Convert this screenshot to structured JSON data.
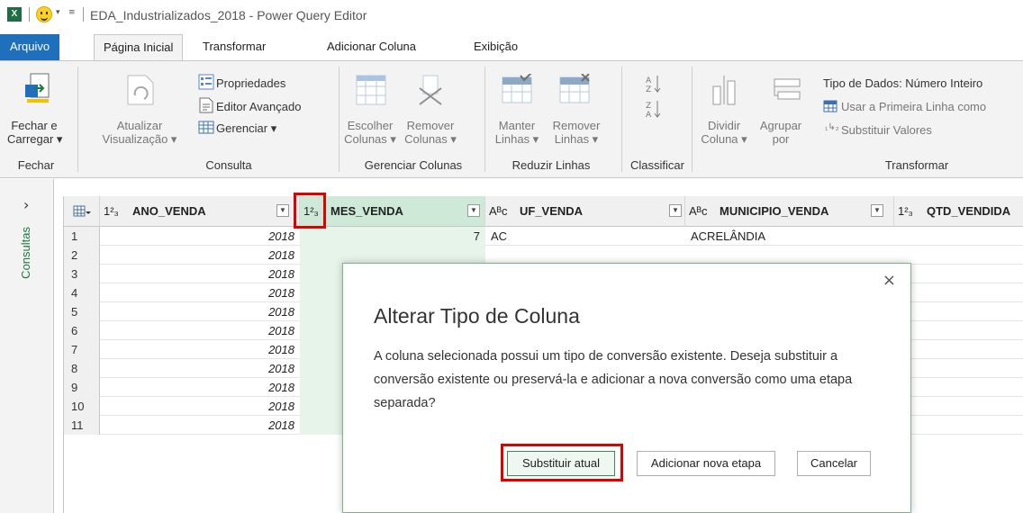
{
  "window": {
    "title": "EDA_Industrializados_2018 - Power Query Editor",
    "app_icon": "X"
  },
  "tabs": [
    "Arquivo",
    "Página Inicial",
    "Transformar",
    "Adicionar Coluna",
    "Exibição"
  ],
  "ribbon": {
    "fechar": {
      "button": "Fechar e Carregar",
      "line1": "Fechar e",
      "line2": "Carregar ▾",
      "group": "Fechar"
    },
    "consulta": {
      "atualizar_line1": "Atualizar",
      "atualizar_line2": "Visualização ▾",
      "propriedades": "Propriedades",
      "editor_avancado": "Editor Avançado",
      "gerenciar": "Gerenciar ▾",
      "group": "Consulta"
    },
    "gerenciar_colunas": {
      "escolher_line1": "Escolher",
      "escolher_line2": "Colunas ▾",
      "remover_line1": "Remover",
      "remover_line2": "Colunas ▾",
      "group": "Gerenciar Colunas"
    },
    "reduzir_linhas": {
      "manter_line1": "Manter",
      "manter_line2": "Linhas ▾",
      "remover_line1": "Remover",
      "remover_line2": "Linhas ▾",
      "group": "Reduzir Linhas"
    },
    "classificar": {
      "group": "Classificar"
    },
    "transformar": {
      "dividir_line1": "Dividir",
      "dividir_line2": "Coluna ▾",
      "agrupar_line1": "Agrupar",
      "agrupar_line2": "por",
      "tipo_dados": "Tipo de Dados: Número Inteiro",
      "primeira_linha": "Usar a Primeira Linha como",
      "substituir_valores": "Substituir Valores",
      "group": "Transformar"
    }
  },
  "queries_pane": {
    "label": "Consultas",
    "chevron": "›"
  },
  "grid": {
    "columns": [
      {
        "type": "1²₃",
        "name": "ANO_VENDA"
      },
      {
        "type": "1²₃",
        "name": "MES_VENDA"
      },
      {
        "type": "Aᴮc",
        "name": "UF_VENDA"
      },
      {
        "type": "Aᴮc",
        "name": "MUNICIPIO_VENDA"
      },
      {
        "type": "1²₃",
        "name": "QTD_VENDIDA"
      }
    ],
    "rows": [
      {
        "n": "1",
        "ano": "2018",
        "mes": "7",
        "uf": "AC",
        "mun": "ACRELÂNDIA"
      },
      {
        "n": "2",
        "ano": "2018",
        "mes": "",
        "uf": "",
        "mun": ""
      },
      {
        "n": "3",
        "ano": "2018",
        "mes": "",
        "uf": "",
        "mun": ""
      },
      {
        "n": "4",
        "ano": "2018",
        "mes": "",
        "uf": "",
        "mun": ""
      },
      {
        "n": "5",
        "ano": "2018",
        "mes": "",
        "uf": "",
        "mun": ""
      },
      {
        "n": "6",
        "ano": "2018",
        "mes": "",
        "uf": "",
        "mun": ""
      },
      {
        "n": "7",
        "ano": "2018",
        "mes": "",
        "uf": "",
        "mun": ""
      },
      {
        "n": "8",
        "ano": "2018",
        "mes": "",
        "uf": "",
        "mun": ""
      },
      {
        "n": "9",
        "ano": "2018",
        "mes": "",
        "uf": "",
        "mun": ""
      },
      {
        "n": "10",
        "ano": "2018",
        "mes": "",
        "uf": "",
        "mun": ""
      },
      {
        "n": "11",
        "ano": "2018",
        "mes": "",
        "uf": "",
        "mun": ""
      }
    ]
  },
  "dialog": {
    "title": "Alterar Tipo de Coluna",
    "message": "A coluna selecionada possui um tipo de conversão existente. Deseja substituir a conversão existente ou preservá-la e adicionar a nova conversão como uma etapa separada?",
    "replace_button": "Substituir atual",
    "add_step_button": "Adicionar nova etapa",
    "cancel_button": "Cancelar",
    "close": "×"
  },
  "colors": {
    "file_tab": "#1f6fbd",
    "selected_column": "#cfe9d8",
    "highlight": "#e00000",
    "queries_label": "#1d7a3a"
  }
}
